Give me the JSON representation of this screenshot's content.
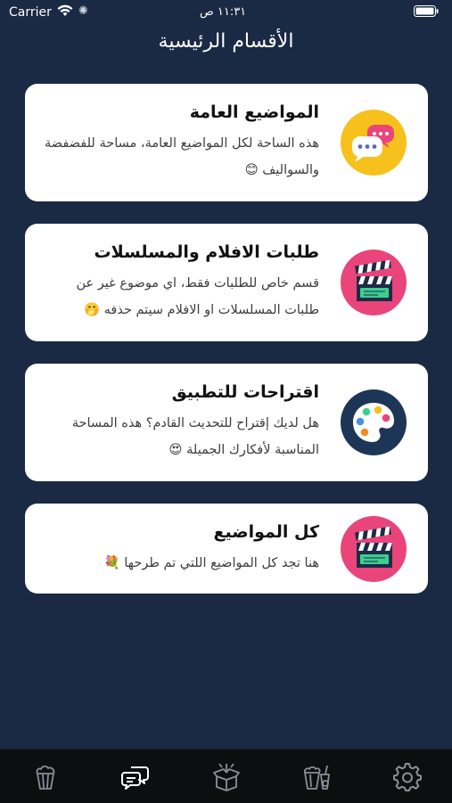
{
  "status_bar": {
    "carrier": "Carrier",
    "time": "١١:٣١ ص"
  },
  "page_title": "الأقسام الرئيسية",
  "cards": [
    {
      "title": "المواضيع العامة",
      "description": "هذه الساحة لكل المواضيع العامة، مساحة للفضفضة والسواليف 😊",
      "icon": "chat-bubbles-icon",
      "icon_bg": "#f6c11c"
    },
    {
      "title": "طلبات الافلام والمسلسلات",
      "description": "قسم خاص للطلبات فقط، اي موضوع غير عن طلبات المسلسلات او الافلام سيتم حذفه 🤭",
      "icon": "clapperboard-icon",
      "icon_bg": "#e9457a"
    },
    {
      "title": "اقتراحات للتطبيق",
      "description": "هل لديك إقتراح للتحديث القادم؟ هذه المساحة المناسبة لأفكارك الجميلة 😍",
      "icon": "palette-icon",
      "icon_bg": "#1d3557"
    },
    {
      "title": "كل المواضيع",
      "description": "هنا تجد كل المواضيع اللتي تم طرحها 💐",
      "icon": "clapperboard-icon",
      "icon_bg": "#e9457a"
    }
  ],
  "tab_bar": [
    {
      "name": "popcorn-tab",
      "icon": "popcorn-icon"
    },
    {
      "name": "chat-tab",
      "icon": "chat-icon",
      "active": true
    },
    {
      "name": "box-tab",
      "icon": "gift-box-icon"
    },
    {
      "name": "snacks-tab",
      "icon": "snacks-icon"
    },
    {
      "name": "settings-tab",
      "icon": "gear-icon"
    }
  ]
}
